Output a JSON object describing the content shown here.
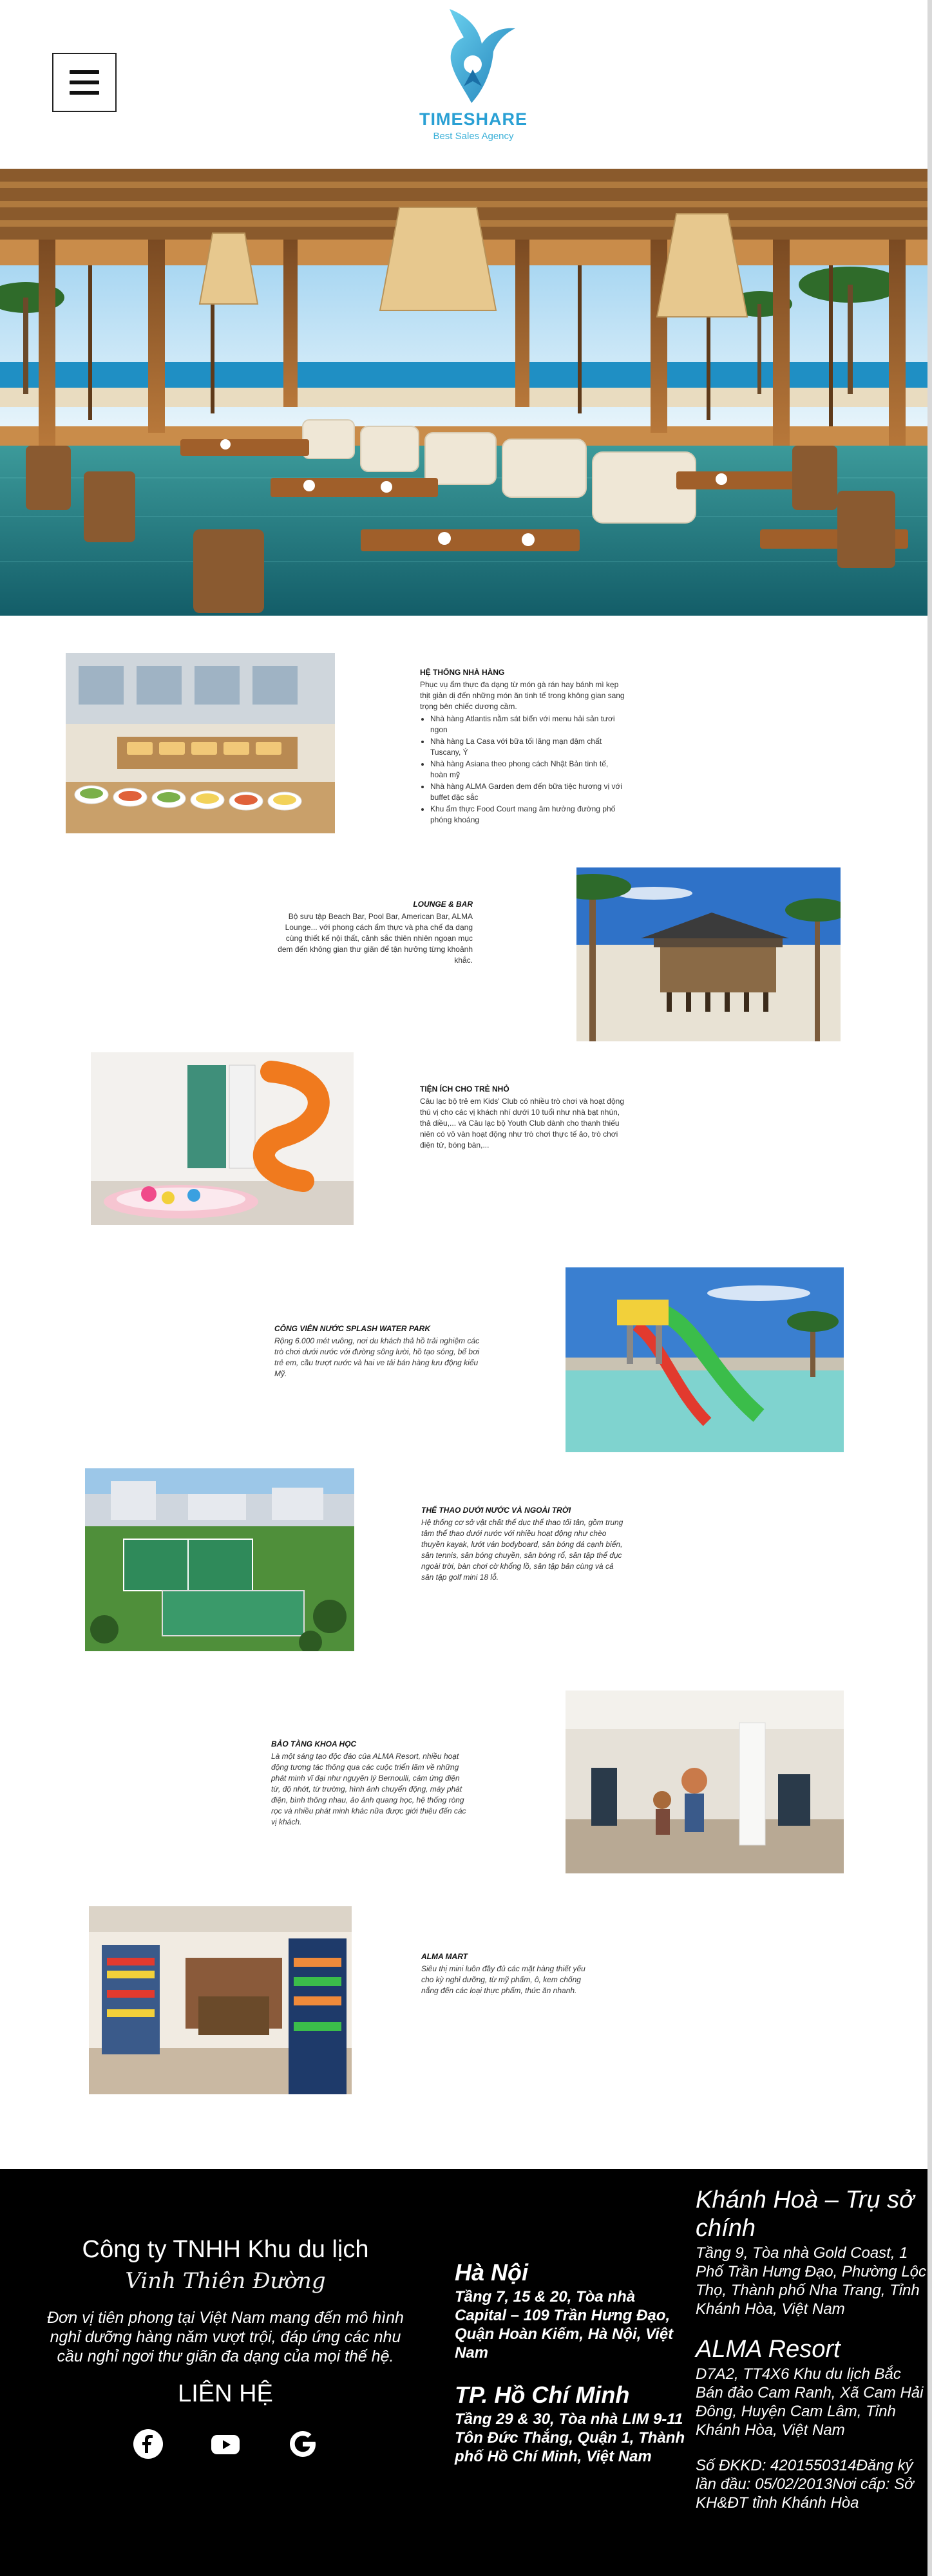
{
  "header": {
    "logo_name": "TIMESHARE",
    "logo_tagline": "Best Sales Agency"
  },
  "sections": [
    {
      "title": "HỆ THỐNG NHÀ HÀNG",
      "intro": "Phục vụ ẩm thực đa dạng từ món gà rán hay bánh mì kẹp thịt giản dị đến những món ăn tinh tế trong không gian sang trọng bên chiếc dương cầm.",
      "bullets": [
        "Nhà hàng Atlantis nằm sát biển với menu hải sản tươi ngon",
        "Nhà hàng La Casa với bữa tối lãng mạn đậm chất Tuscany, Ý",
        "Nhà hàng Asiana theo phong cách Nhật Bản tinh tế, hoàn mỹ",
        "Nhà hàng ALMA Garden đem đến bữa tiệc hương vị với buffet đặc sắc",
        "Khu ẩm thực Food Court mang âm hưởng đường phố phóng khoáng"
      ]
    },
    {
      "title": "LOUNGE & BAR",
      "body": "Bộ sưu tập Beach Bar, Pool Bar, American Bar, ALMA Lounge... với phong cách ẩm thực và pha chế đa dạng cùng thiết kế nội thất, cảnh sắc thiên nhiên ngoạn mục đem đến không gian thư giãn để tận hưởng từng khoảnh khắc."
    },
    {
      "title": "TIỆN ÍCH CHO TRẺ NHỎ",
      "body": "Câu lạc bộ trẻ em Kids' Club có nhiều trò chơi và hoạt động thú vị cho các vị khách nhí dưới 10 tuổi như nhà bạt nhún, thả diều,... và Câu lạc bộ Youth Club dành cho thanh thiếu niên có vô vàn hoạt động như trò chơi thực tế ảo, trò chơi điện tử, bóng bàn,..."
    },
    {
      "title": "CÔNG VIÊN NƯỚC SPLASH WATER PARK",
      "body": "Rộng 6.000 mét vuông, nơi du khách thả hồ trải nghiệm các trò chơi dưới nước với đường sông lười, hồ tạo sóng, bể bơi trẻ em, cầu trượt nước và hai ve tải bán hàng lưu động kiểu Mỹ."
    },
    {
      "title": "THỂ THAO DƯỚI NƯỚC VÀ NGOÀI TRỜI",
      "body": "Hệ thống cơ sở vật chất thể dục thể thao tối tân, gồm trung tâm thể thao dưới nước với nhiều hoạt động như chèo thuyền kayak, lướt ván bodyboard, sân bóng đá cạnh biển, sân tennis, sân bóng chuyền, sân bóng rổ, sân tập thể dục ngoài trời, bàn chơi cờ khổng lồ, sân tập bản cùng và cả sân tập golf mini 18 lỗ."
    },
    {
      "title": "BẢO TÀNG KHOA HỌC",
      "body": "Là một sáng tạo độc đáo của ALMA Resort, nhiều hoạt động tương tác thông qua các cuộc triển lãm về những phát minh vĩ đại như nguyên lý Bernoulli, cảm ứng điện từ, độ nhớt, từ trường, hình ảnh chuyển động, máy phát điện, bình thông nhau, ảo ảnh quang học, hệ thống ròng rọc và nhiều phát minh khác nữa được giới thiệu đến các vị khách."
    },
    {
      "title": "ALMA MART",
      "body": "Siêu thị mini luôn đầy đủ các mặt hàng thiết yếu cho kỳ nghỉ dưỡng, từ mỹ phẩm, ô, kem chống nắng đến các loại thực phẩm, thức ăn nhanh."
    }
  ],
  "footer": {
    "company_name": "Công ty TNHH Khu du lịch",
    "company_script": "Vinh Thiên Đường",
    "company_desc": "Đơn vị tiên phong tại Việt Nam mang đến mô hình nghỉ dưỡng hàng năm vượt trội, đáp ứng các nhu cầu nghỉ ngơi thư giãn đa dạng của mọi thế hệ.",
    "contact_title": "LIÊN HỆ",
    "offices_mid": [
      {
        "name": "Hà Nội",
        "address": "Tầng 7, 15 & 20, Tòa nhà Capital – 109 Trần Hưng Đạo, Quận Hoàn Kiếm, Hà Nội, Việt Nam"
      },
      {
        "name": "TP. Hồ Chí Minh",
        "address": "Tầng 29 & 30, Tòa nhà LIM 9-11 Tôn Đức Thắng, Quận 1, Thành phố Hồ Chí Minh, Việt Nam"
      }
    ],
    "offices_right": [
      {
        "name": "Khánh Hoà – Trụ sở chính",
        "address": "Tầng 9, Tòa nhà Gold Coast, 1 Phố Trần Hưng Đạo, Phường Lộc Thọ, Thành phố Nha Trang, Tỉnh Khánh Hòa, Việt Nam"
      },
      {
        "name": "ALMA Resort",
        "address": "D7A2, TT4X6 Khu du lịch Bắc Bán đảo Cam Ranh, Xã Cam Hải Đông, Huyện Cam Lâm, Tỉnh Khánh Hòa, Việt Nam"
      }
    ],
    "registration": "Số ĐKKD: 4201550314Đăng ký lần đầu: 05/02/2013Nơi cấp: Sở KH&ĐT tỉnh Khánh Hòa",
    "socials": [
      "facebook-icon",
      "youtube-icon",
      "google-icon"
    ]
  }
}
